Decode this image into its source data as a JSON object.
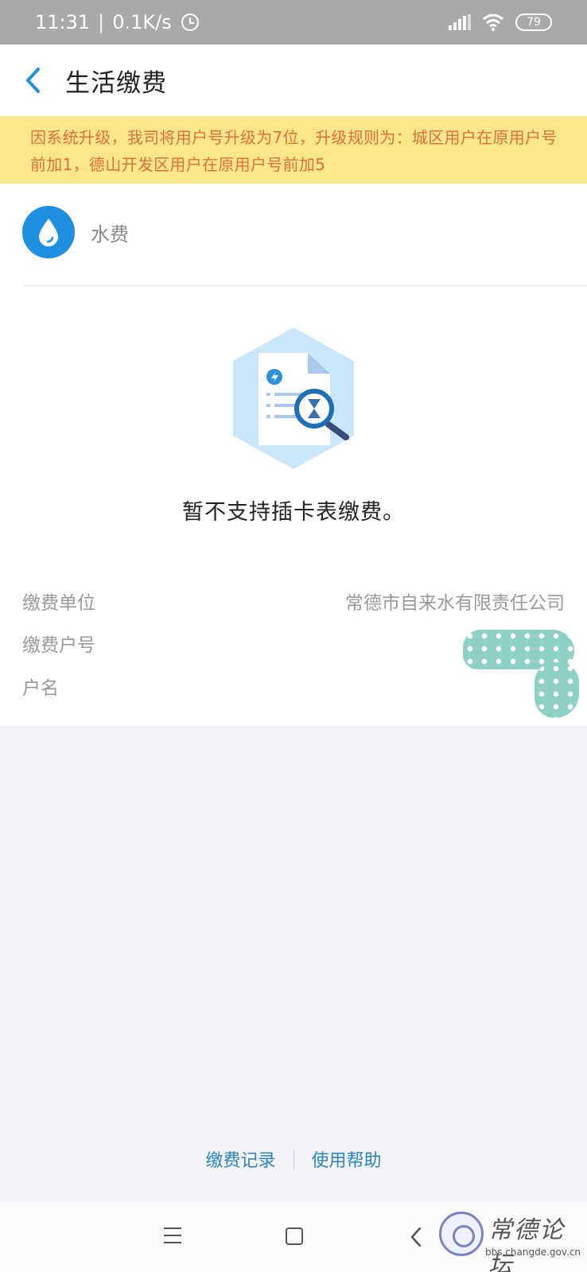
{
  "status_bar": {
    "time": "11:31",
    "separator": "|",
    "speed": "0.1K/s",
    "battery": "79",
    "icons": [
      "alarm-icon",
      "signal-icon",
      "wifi-icon",
      "battery-icon"
    ]
  },
  "header": {
    "title": "生活缴费",
    "back_icon": "chevron-left-icon"
  },
  "notice": {
    "text": "因系统升级，我司将用户号升级为7位，升级规则为：城区用户在原用户号前加1，德山开发区用户在原用户号前加5"
  },
  "service": {
    "name": "水费",
    "icon": "water-drop-icon"
  },
  "empty_state": {
    "illustration": "document-search-icon",
    "message": "暂不支持插卡表缴费。"
  },
  "info": {
    "unit_label": "缴费单位",
    "unit_value": "常德市自来水有限责任公司",
    "account_label": "缴费户号",
    "account_value": "",
    "name_label": "户名",
    "name_value": ""
  },
  "footer": {
    "records_label": "缴费记录",
    "help_label": "使用帮助"
  },
  "nav_bar": {
    "icons": [
      "menu-icon",
      "home-icon",
      "back-icon"
    ]
  },
  "watermark": {
    "title": "常德论坛",
    "url": "bbs.changde.gov.cn"
  },
  "colors": {
    "accent": "#1e8fe1",
    "link": "#2a84c4",
    "notice_bg": "#fbe78b",
    "notice_text": "#e0703a",
    "status_bar": "#a9a9a9"
  }
}
